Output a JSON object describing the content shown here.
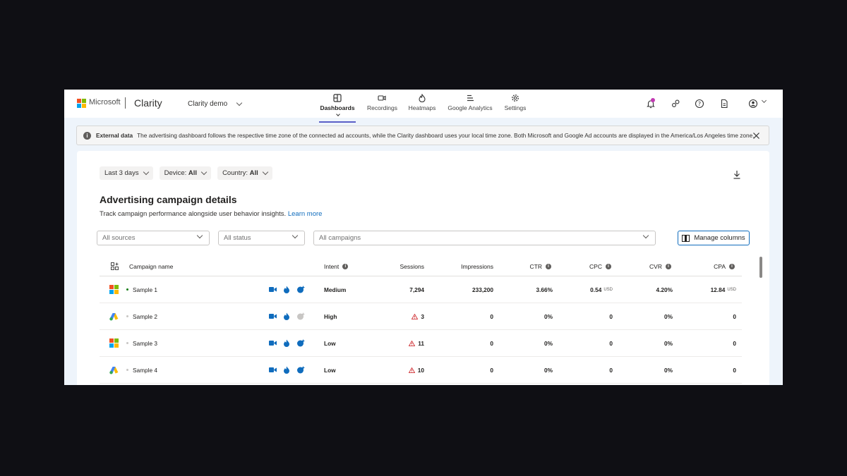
{
  "header": {
    "brand_company": "Microsoft",
    "brand_app": "Clarity",
    "project_name": "Clarity demo",
    "nav": [
      {
        "label": "Dashboards",
        "icon": "dashboard-icon",
        "active": true
      },
      {
        "label": "Recordings",
        "icon": "video-icon"
      },
      {
        "label": "Heatmaps",
        "icon": "flame-icon"
      },
      {
        "label": "Google Analytics",
        "icon": "analytics-icon"
      },
      {
        "label": "Settings",
        "icon": "gear-icon"
      }
    ]
  },
  "banner": {
    "label": "External data",
    "message": "The advertising dashboard follows the respective time zone of the connected ad accounts, while the Clarity dashboard uses your local time zone. Both Microsoft and Google Ad accounts are displayed in the America/Los Angeles time zone."
  },
  "filters": {
    "date": "Last 3 days",
    "device_label": "Device:",
    "device_value": "All",
    "country_label": "Country:",
    "country_value": "All"
  },
  "section": {
    "title": "Advertising campaign details",
    "subtitle": "Track campaign performance alongside user behavior insights.",
    "learn_more": "Learn more"
  },
  "selects": {
    "sources": "All sources",
    "status": "All status",
    "campaigns": "All campaigns",
    "manage_columns": "Manage columns"
  },
  "table": {
    "columns": {
      "name": "Campaign name",
      "intent": "Intent",
      "sessions": "Sessions",
      "impressions": "Impressions",
      "ctr": "CTR",
      "cpc": "CPC",
      "cvr": "CVR",
      "cpa": "CPA"
    },
    "currency": "USD",
    "rows": [
      {
        "source": "microsoft",
        "name": "Sample 1",
        "status": "active",
        "intent": "Medium",
        "sessions": "7,294",
        "warn": false,
        "impressions": "233,200",
        "ctr": "3.66%",
        "cpc": "0.54",
        "cvr": "4.20%",
        "cpa": "12.84",
        "heat_available": true
      },
      {
        "source": "google",
        "name": "Sample 2",
        "status": "paused",
        "intent": "High",
        "sessions": "3",
        "warn": true,
        "impressions": "0",
        "ctr": "0%",
        "cpc": "0",
        "cvr": "0%",
        "cpa": "0",
        "heat_available": false
      },
      {
        "source": "microsoft",
        "name": "Sample 3",
        "status": "paused",
        "intent": "Low",
        "sessions": "11",
        "warn": true,
        "impressions": "0",
        "ctr": "0%",
        "cpc": "0",
        "cvr": "0%",
        "cpa": "0",
        "heat_available": true
      },
      {
        "source": "google",
        "name": "Sample 4",
        "status": "paused",
        "intent": "Low",
        "sessions": "10",
        "warn": true,
        "impressions": "0",
        "ctr": "0%",
        "cpc": "0",
        "cvr": "0%",
        "cpa": "0",
        "heat_available": true
      }
    ]
  },
  "colors": {
    "accent": "#0f6cbd",
    "nav_underline": "#5b5fc7",
    "active_status": "#107c10",
    "warning": "#d13438",
    "notification": "#c239b3"
  }
}
